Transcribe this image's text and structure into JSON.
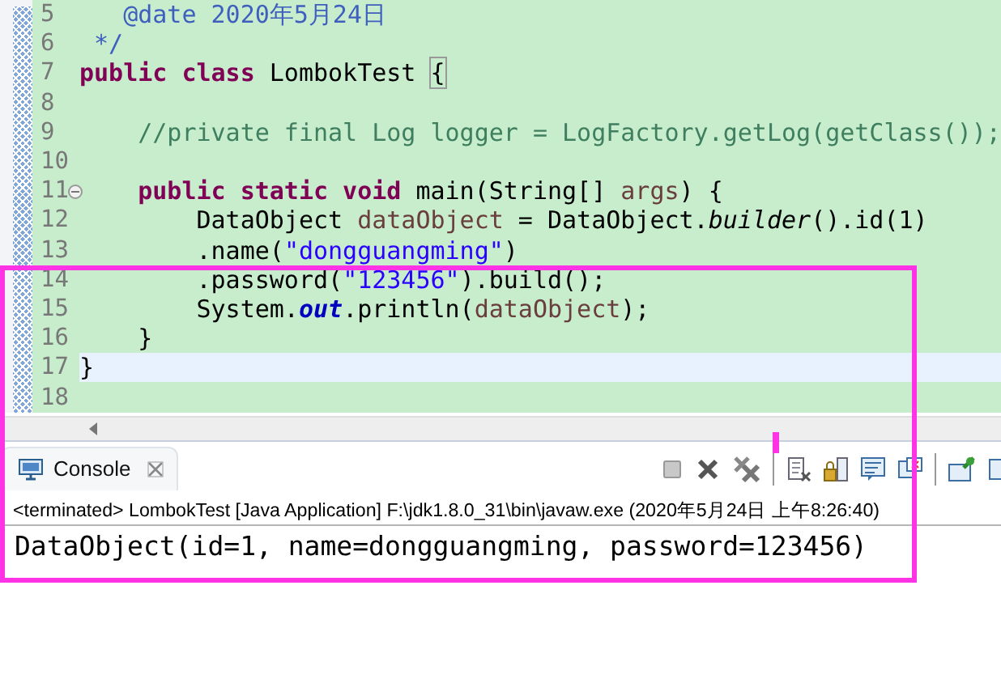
{
  "editor": {
    "lines": [
      {
        "number": "5",
        "current": false,
        "foldable": false,
        "tokens": [
          {
            "kind": "doc",
            "text": "   @date 2020年5月24日"
          }
        ]
      },
      {
        "number": "6",
        "current": false,
        "foldable": false,
        "tokens": [
          {
            "kind": "doc",
            "text": " */"
          }
        ]
      },
      {
        "number": "7",
        "current": false,
        "foldable": false,
        "tokens": [
          {
            "kind": "kw",
            "text": "public class"
          },
          {
            "kind": "plain",
            "text": " LombokTest "
          },
          {
            "kind": "bracket_match",
            "text": "{"
          }
        ]
      },
      {
        "number": "8",
        "current": false,
        "foldable": false
      },
      {
        "number": "9",
        "current": false,
        "foldable": false,
        "tokens": [
          {
            "kind": "comment",
            "text": "    //private final Log logger = LogFactory.getLog(getClass());"
          }
        ]
      },
      {
        "number": "10",
        "current": false,
        "foldable": false
      },
      {
        "number": "11",
        "current": false,
        "foldable": true,
        "tokens": [
          {
            "kind": "kw",
            "text": "    public static void"
          },
          {
            "kind": "plain",
            "text": " main(String[] "
          },
          {
            "kind": "var",
            "text": "args"
          },
          {
            "kind": "plain",
            "text": ") {"
          }
        ]
      },
      {
        "number": "12",
        "current": false,
        "foldable": false,
        "tokens": [
          {
            "kind": "plain",
            "text": "        DataObject "
          },
          {
            "kind": "var",
            "text": "dataObject"
          },
          {
            "kind": "plain",
            "text": " = DataObject."
          },
          {
            "kind": "static",
            "text": "builder"
          },
          {
            "kind": "plain",
            "text": "().id(1)"
          }
        ]
      },
      {
        "number": "13",
        "current": false,
        "foldable": false,
        "tokens": [
          {
            "kind": "plain",
            "text": "        .name("
          },
          {
            "kind": "str",
            "text": "\"dongguangming\""
          },
          {
            "kind": "plain",
            "text": ")"
          }
        ]
      },
      {
        "number": "14",
        "current": false,
        "foldable": false,
        "tokens": [
          {
            "kind": "plain",
            "text": "        .password("
          },
          {
            "kind": "str",
            "text": "\"123456\""
          },
          {
            "kind": "plain",
            "text": ").build();"
          }
        ]
      },
      {
        "number": "15",
        "current": false,
        "foldable": false,
        "tokens": [
          {
            "kind": "plain",
            "text": "        System."
          },
          {
            "kind": "field",
            "text": "out"
          },
          {
            "kind": "plain",
            "text": ".println("
          },
          {
            "kind": "var",
            "text": "dataObject"
          },
          {
            "kind": "plain",
            "text": ");"
          }
        ]
      },
      {
        "number": "16",
        "current": false,
        "foldable": false,
        "tokens": [
          {
            "kind": "plain",
            "text": "    }"
          }
        ]
      },
      {
        "number": "17",
        "current": true,
        "foldable": false,
        "tokens": [
          {
            "kind": "plain",
            "text": "}"
          }
        ]
      },
      {
        "number": "18",
        "current": false,
        "foldable": false
      }
    ]
  },
  "console": {
    "tab": {
      "label": "Console",
      "selected": true
    },
    "status": "<terminated> LombokTest [Java Application] F:\\jdk1.8.0_31\\bin\\javaw.exe (2020年5月24日 上午8:26:40)",
    "output": "DataObject(id=1, name=dongguangming, password=123456)"
  }
}
